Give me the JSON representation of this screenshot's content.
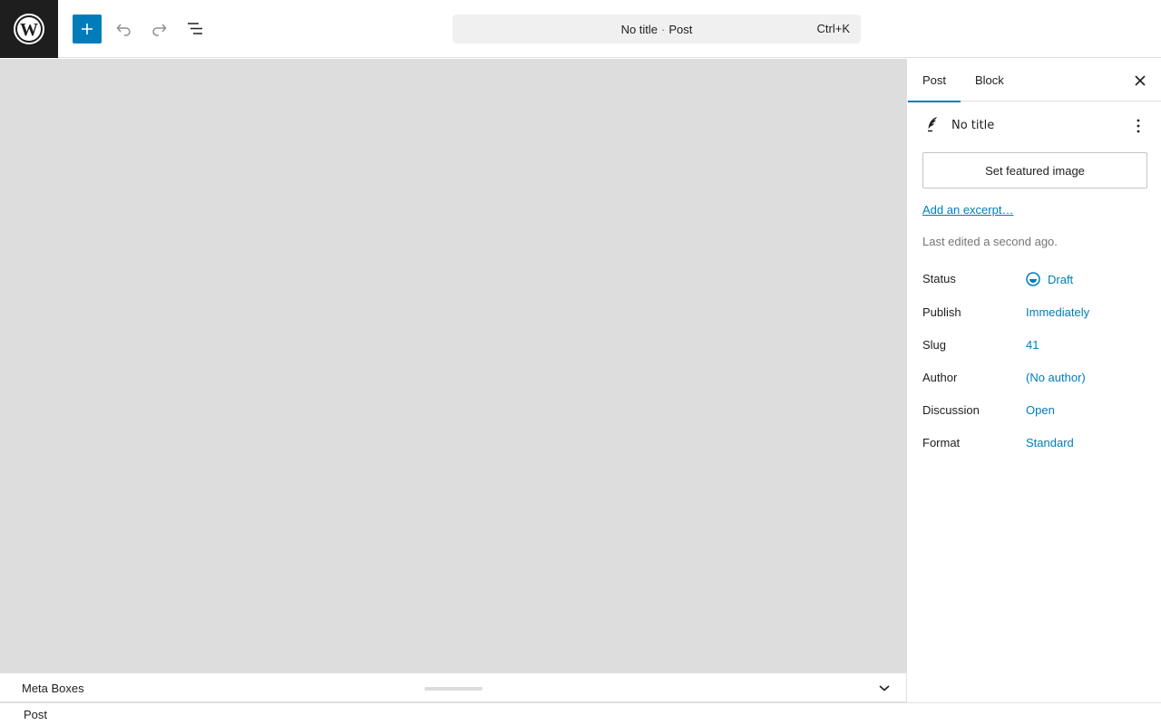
{
  "toolbar": {
    "command_title": "No title",
    "command_sep": "·",
    "command_type": "Post",
    "command_shortcut": "Ctrl+K"
  },
  "sidebar": {
    "tabs": [
      {
        "label": "Post",
        "active": true
      },
      {
        "label": "Block",
        "active": false
      }
    ],
    "post_title": "No title",
    "featured_image_label": "Set featured image",
    "excerpt_link": "Add an excerpt…",
    "last_edited": "Last edited a second ago.",
    "fields": [
      {
        "key": "Status",
        "value": "Draft"
      },
      {
        "key": "Publish",
        "value": "Immediately"
      },
      {
        "key": "Slug",
        "value": "41"
      },
      {
        "key": "Author",
        "value": "(No author)"
      },
      {
        "key": "Discussion",
        "value": "Open"
      },
      {
        "key": "Format",
        "value": "Standard"
      }
    ]
  },
  "metabox": {
    "label": "Meta Boxes"
  },
  "footer": {
    "breadcrumb": "Post"
  },
  "colors": {
    "accent": "#007cba",
    "canvas": "#dddddd",
    "logo_bg": "#1e1e1e"
  },
  "icons": [
    "wordpress-logo-icon",
    "plus-icon",
    "undo-icon",
    "redo-icon",
    "document-overview-icon",
    "close-icon",
    "feather-icon",
    "more-vertical-icon",
    "draft-status-icon",
    "chevron-down-icon"
  ]
}
